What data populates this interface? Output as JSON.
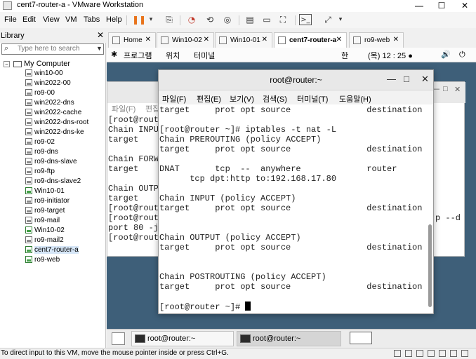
{
  "window": {
    "title": "cent7-router-a - VMware Workstation",
    "minimize": "—",
    "maximize": "☐",
    "close": "✕"
  },
  "menu": [
    "File",
    "Edit",
    "View",
    "VM",
    "Tabs",
    "Help"
  ],
  "library": {
    "title": "Library",
    "close": "✕",
    "search_placeholder": "Type here to search",
    "root": "My Computer",
    "vms": [
      {
        "name": "win10-00",
        "on": false
      },
      {
        "name": "win2022-00",
        "on": false
      },
      {
        "name": "ro9-00",
        "on": false
      },
      {
        "name": "win2022-dns",
        "on": false
      },
      {
        "name": "win2022-cache",
        "on": false
      },
      {
        "name": "win2022-dns-root",
        "on": false
      },
      {
        "name": "win2022-dns-ke",
        "on": false
      },
      {
        "name": "ro9-02",
        "on": false
      },
      {
        "name": "ro9-dns",
        "on": false
      },
      {
        "name": "ro9-dns-slave",
        "on": false
      },
      {
        "name": "ro9-ftp",
        "on": false
      },
      {
        "name": "ro9-dns-slave2",
        "on": false
      },
      {
        "name": "Win10-01",
        "on": true
      },
      {
        "name": "ro9-initiator",
        "on": false
      },
      {
        "name": "ro9-target",
        "on": false
      },
      {
        "name": "ro9-mail",
        "on": false
      },
      {
        "name": "Win10-02",
        "on": true
      },
      {
        "name": "ro9-mail2",
        "on": false
      },
      {
        "name": "cent7-router-a",
        "on": true,
        "selected": true
      },
      {
        "name": "ro9-web",
        "on": true
      }
    ]
  },
  "tabs": [
    {
      "label": "Home",
      "close": "✕"
    },
    {
      "label": "Win10-02",
      "close": "✕"
    },
    {
      "label": "Win10-01",
      "close": "✕"
    },
    {
      "label": "cent7-router-a",
      "close": "✕",
      "active": true
    },
    {
      "label": "ro9-web",
      "close": "✕"
    }
  ],
  "gnome": {
    "menu_icon": "✱",
    "programs": "프로그램",
    "places": "위치",
    "terminal": "터미널",
    "ime": "한",
    "clock": "(목) 12 : 25 ●",
    "volume": "🔊",
    "power": "⏻"
  },
  "back_terminal": {
    "menu": [
      "파일(F)",
      "편집"
    ],
    "lines": [
      "[root@route",
      "Chain INPUT",
      "target",
      "",
      "Chain FORWA",
      "target",
      "",
      "Chain OUTPU",
      "target",
      "[root@route",
      "[root@route",
      "port 80 -j",
      "[root@route"
    ],
    "right_fragment": "p --d"
  },
  "terminal": {
    "title": "root@router:~",
    "minimize": "—",
    "maximize": "□",
    "close": "✕",
    "menu": [
      "파일(F)",
      "편집(E)",
      "보기(V)",
      "검색(S)",
      "터미널(T)",
      "도움말(H)"
    ],
    "lines": [
      "target     prot opt source               destination",
      "",
      "[root@router ~]# iptables -t nat -L",
      "Chain PREROUTING (policy ACCEPT)",
      "target     prot opt source               destination",
      "",
      "DNAT       tcp  --  anywhere             router",
      "      tcp dpt:http to:192.168.17.80",
      "",
      "Chain INPUT (policy ACCEPT)",
      "target     prot opt source               destination",
      "",
      "",
      "Chain OUTPUT (policy ACCEPT)",
      "target     prot opt source               destination",
      "",
      "",
      "Chain POSTROUTING (policy ACCEPT)",
      "target     prot opt source               destination",
      "",
      "[root@router ~]# "
    ]
  },
  "taskbar": {
    "buttons": [
      {
        "label": "root@router:~",
        "active": false
      },
      {
        "label": "root@router:~",
        "active": true
      }
    ]
  },
  "status": "To direct input to this VM, move the mouse pointer inside or press Ctrl+G."
}
